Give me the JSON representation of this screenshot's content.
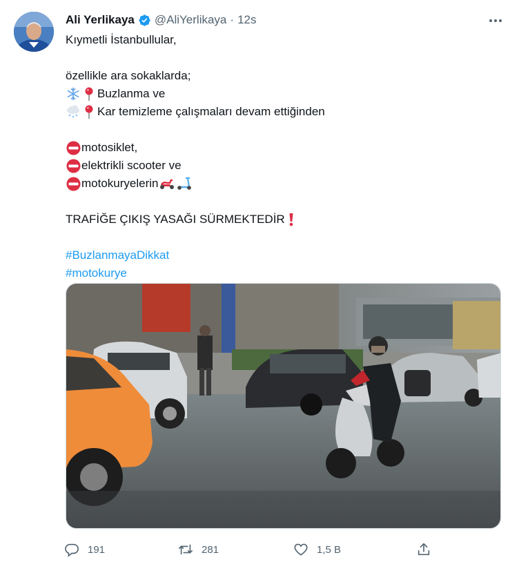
{
  "author": {
    "name": "Ali Yerlikaya",
    "handle": "@AliYerlikaya",
    "time": "12s",
    "verified": true
  },
  "tweet": {
    "lines": [
      "Kıymetli İstanbullular,",
      "özellikle ara sokaklarda;",
      "Buzlanma ve",
      "Kar temizleme çalışmaları devam ettiğinden",
      "motosiklet,",
      "elektrikli scooter ve",
      "motokuryelerin",
      "TRAFİĞE ÇIKIŞ YASAĞI SÜRMEKTEDİR"
    ],
    "hashtags": [
      "#BuzlanmayaDikkat",
      "#motokurye"
    ]
  },
  "icons": {
    "verified": "verified-badge-icon",
    "snowflake": "snowflake-icon",
    "pin": "red-pushpin-icon",
    "snow_cloud": "snow-cloud-icon",
    "no_entry": "no-entry-icon",
    "motor_scooter": "motor-scooter-icon",
    "kick_scooter": "kick-scooter-icon",
    "exclamation": "red-exclamation-icon"
  },
  "actions": {
    "reply_count": "191",
    "retweet_count": "281",
    "like_count": "1,5 B"
  },
  "colors": {
    "accent": "#1d9bf0",
    "secondary_text": "#536471",
    "text": "#0f1419"
  }
}
